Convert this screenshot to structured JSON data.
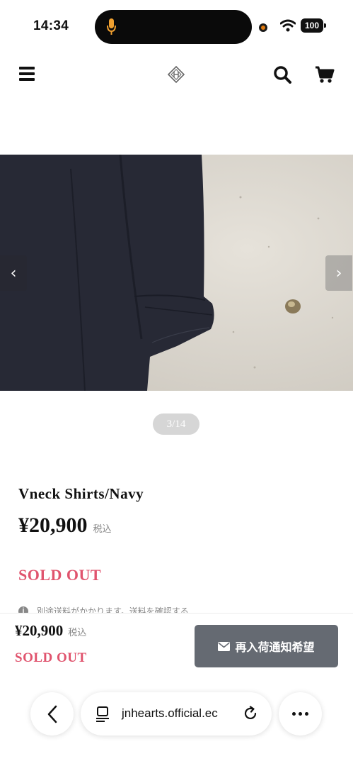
{
  "status_bar": {
    "time": "14:34",
    "battery": "100"
  },
  "header": {
    "menu_icon": "hamburger-icon",
    "logo_icon": "brand-logo-icon",
    "search_icon": "search-icon",
    "cart_icon": "cart-icon"
  },
  "gallery": {
    "counter": "3/14",
    "prev_icon": "chevron-left-icon",
    "next_icon": "chevron-right-icon"
  },
  "product": {
    "name": "Vneck Shirts/Navy",
    "price": "¥20,900",
    "tax_label": "税込",
    "status": "SOLD OUT",
    "shipping_note": "別途送料がかかります。送料を確認する"
  },
  "sticky_bar": {
    "price": "¥20,900",
    "tax_label": "税込",
    "status": "SOLD OUT",
    "notify_button": "再入荷通知希望"
  },
  "browser": {
    "url": "jnhearts.official.ec"
  },
  "colors": {
    "sold_out": "#e0546e",
    "notify_button_bg": "#656a72",
    "shirt": "#272935",
    "wall": "#dcd7ce"
  }
}
